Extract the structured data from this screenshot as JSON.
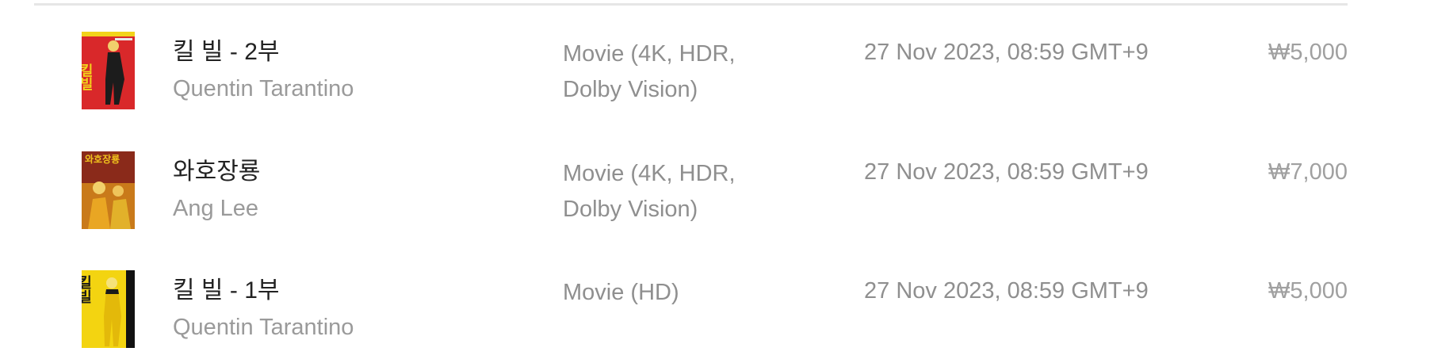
{
  "purchases": [
    {
      "title": "킬 빌 - 2부",
      "creator": "Quentin Tarantino",
      "format": "Movie (4K, HDR, Dolby Vision)",
      "date": "27 Nov 2023, 08:59 GMT+9",
      "price": "₩5,000",
      "poster_text": "킬빌",
      "poster_colors": {
        "bg": "#d9282a",
        "accent": "#f2d31b",
        "figure": "#1c1c1c"
      }
    },
    {
      "title": "와호장룡",
      "creator": "Ang Lee",
      "format": "Movie (4K, HDR, Dolby Vision)",
      "date": "27 Nov 2023, 08:59 GMT+9",
      "price": "₩7,000",
      "poster_text": "와호장룡",
      "poster_colors": {
        "bg": "#8a2a1a",
        "accent": "#f0c21d",
        "figure": "#e9a623"
      }
    },
    {
      "title": "킬 빌 - 1부",
      "creator": "Quentin Tarantino",
      "format": "Movie (HD)",
      "date": "27 Nov 2023, 08:59 GMT+9",
      "price": "₩5,000",
      "poster_text": "킬빌",
      "poster_colors": {
        "bg": "#f3d411",
        "accent": "#1a1a1a",
        "figure": "#e3b90a"
      }
    }
  ]
}
